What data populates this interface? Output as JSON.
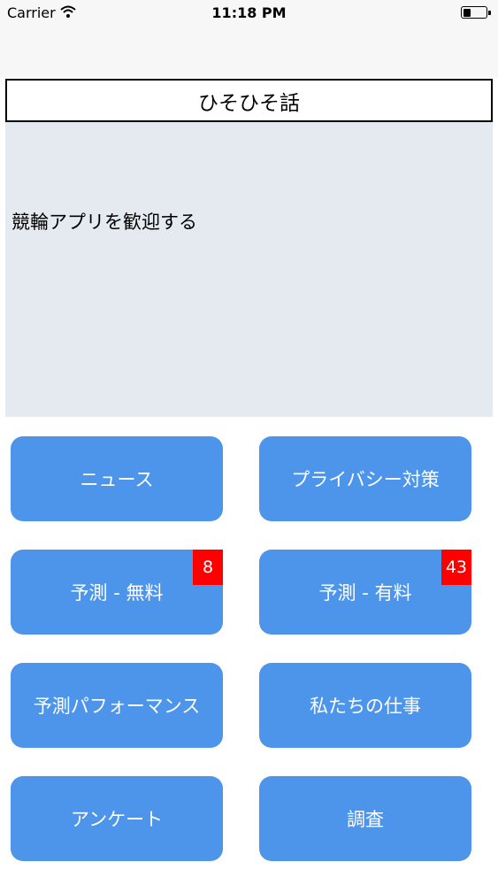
{
  "status_bar": {
    "carrier": "Carrier",
    "time": "11:18 PM"
  },
  "header": {
    "title": "ひそひそ話"
  },
  "welcome": {
    "text": "競輪アプリを歓迎する"
  },
  "menu": {
    "news": "ニュース",
    "privacy": "プライバシー対策",
    "prediction_free": "予測 - 無料",
    "prediction_free_badge": "8",
    "prediction_paid": "予測 - 有料",
    "prediction_paid_badge": "43",
    "prediction_performance": "予測パフォーマンス",
    "our_work": "私たちの仕事",
    "questionnaire": "アンケート",
    "survey": "調査"
  },
  "colors": {
    "button": "#4d95ea",
    "badge": "#ff0000",
    "panel": "#e4eaef"
  }
}
